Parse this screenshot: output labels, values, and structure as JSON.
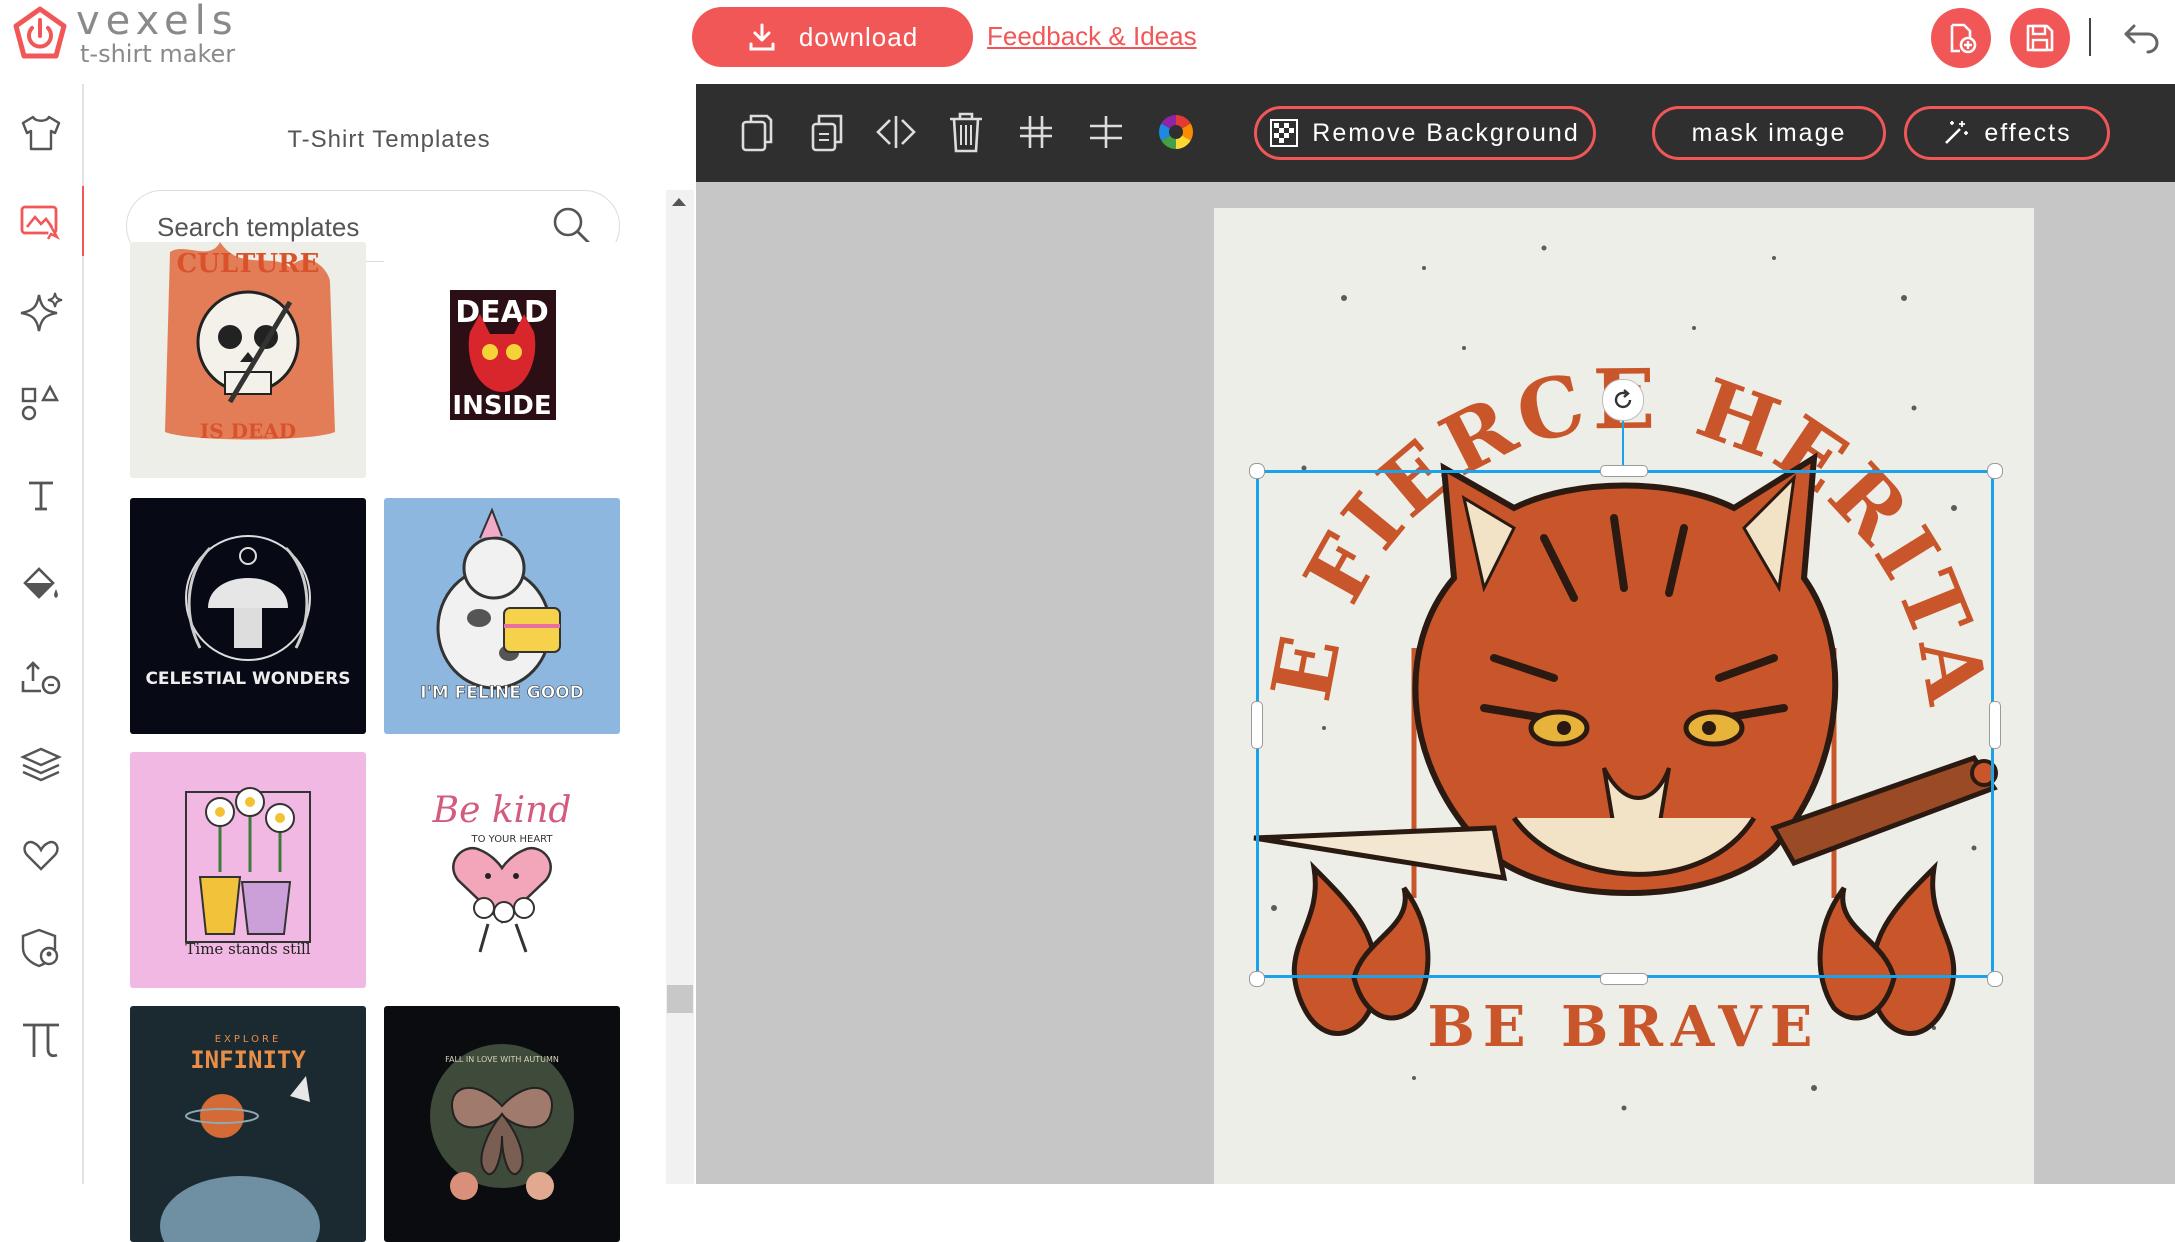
{
  "brand": {
    "name": "vexels",
    "subtitle": "t-shirt maker",
    "color": "#f25757"
  },
  "header": {
    "download_label": "download",
    "feedback_label": "Feedback & Ideas",
    "icons": [
      "add-page-icon",
      "save-icon",
      "undo-icon"
    ]
  },
  "rail": {
    "icons": [
      "tshirt-icon",
      "templates-icon",
      "ai-sparkle-icon",
      "shapes-icon",
      "text-icon",
      "fill-bucket-icon",
      "upload-icon",
      "layers-icon",
      "favorites-icon",
      "badge-icon",
      "pi-icon"
    ],
    "active": "templates-icon"
  },
  "templates_panel": {
    "title": "T-Shirt Templates",
    "search_placeholder": "Search templates",
    "tiles": [
      {
        "top_text": "CULTURE",
        "bottom_text": "IS DEAD",
        "bg": "#eeeee8"
      },
      {
        "top_text": "DEAD",
        "bottom_text": "INSIDE",
        "bg": "#ffffff"
      },
      {
        "text": "CELESTIAL WONDERS",
        "bg": "#070a14"
      },
      {
        "text": "I'M FELINE GOOD",
        "bg": "#8db7df"
      },
      {
        "text": "Time stands still",
        "bg": "#f0b8e2"
      },
      {
        "top_text": "Be kind",
        "bottom_text": "TO YOUR HEART",
        "bg": "#ffffff"
      },
      {
        "top_text": "EXPLORE",
        "bottom_text": "INFINITY",
        "bg": "#1b2a30"
      },
      {
        "text": "FALL IN LOVE WITH AUTUMN",
        "bg": "#0a0c10"
      }
    ]
  },
  "toolbar": {
    "icons": [
      "duplicate-icon",
      "copy-icon",
      "flip-icon",
      "delete-icon",
      "align-center-icon",
      "align-middle-icon",
      "color-wheel-icon"
    ],
    "remove_background_label": "Remove Background",
    "mask_image_label": "mask image",
    "effects_label": "effects"
  },
  "design": {
    "arc_text": "THE FIERCE HERITAGE",
    "bottom_text": "BE BRAVE",
    "primary_color": "#c9562a",
    "selection_color": "#1aa3e8"
  }
}
